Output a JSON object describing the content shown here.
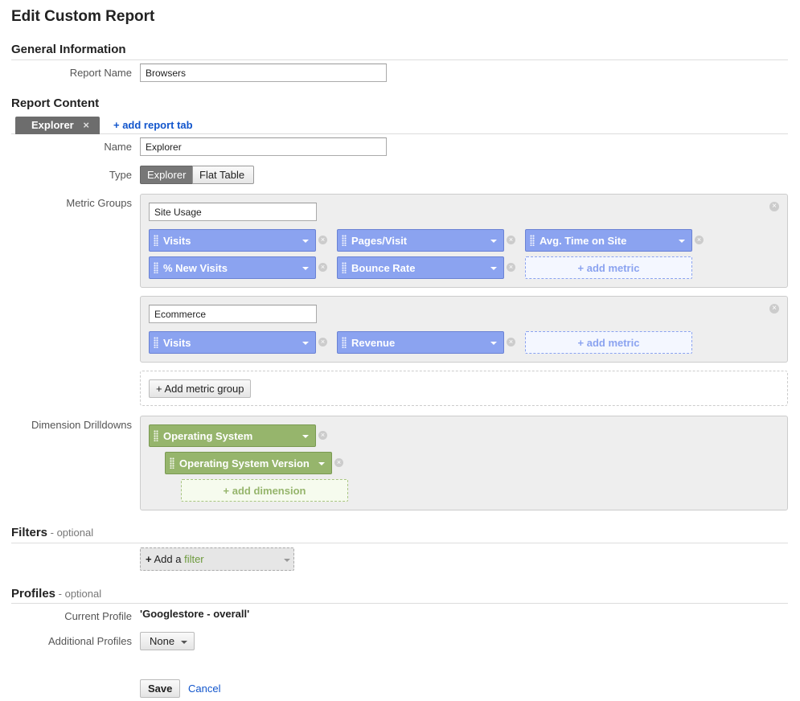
{
  "page": {
    "title": "Edit Custom Report"
  },
  "general": {
    "heading": "General Information",
    "report_name_label": "Report Name",
    "report_name_value": "Browsers"
  },
  "content": {
    "heading": "Report Content",
    "tabs": [
      {
        "label": "Explorer",
        "close": "×"
      }
    ],
    "add_tab": "+ add report tab",
    "name_label": "Name",
    "name_value": "Explorer",
    "type_label": "Type",
    "type_options": [
      "Explorer",
      "Flat Table"
    ],
    "metric_groups_label": "Metric Groups",
    "metric_groups": [
      {
        "name": "Site Usage",
        "metrics": [
          "Visits",
          "Pages/Visit",
          "Avg. Time on Site",
          "% New Visits",
          "Bounce Rate"
        ]
      },
      {
        "name": "Ecommerce",
        "metrics": [
          "Visits",
          "Revenue"
        ]
      }
    ],
    "add_metric": "+ add metric",
    "add_metric_group": "+ Add metric group",
    "dimension_label": "Dimension Drilldowns",
    "dimensions": [
      "Operating System",
      "Operating System Version"
    ],
    "add_dimension": "+ add dimension"
  },
  "filters": {
    "heading": "Filters",
    "optional": " - optional",
    "add_prefix": "+",
    "add_text": " Add a ",
    "add_filter": "filter"
  },
  "profiles": {
    "heading": "Profiles",
    "optional": " - optional",
    "current_label": "Current Profile",
    "current_value": "'Googlestore - overall'",
    "additional_label": "Additional Profiles",
    "additional_value": "None"
  },
  "actions": {
    "save": "Save",
    "cancel": "Cancel"
  },
  "colors": {
    "metric": "#8ba3f0",
    "dimension": "#96b56c",
    "link": "#1155cc"
  }
}
